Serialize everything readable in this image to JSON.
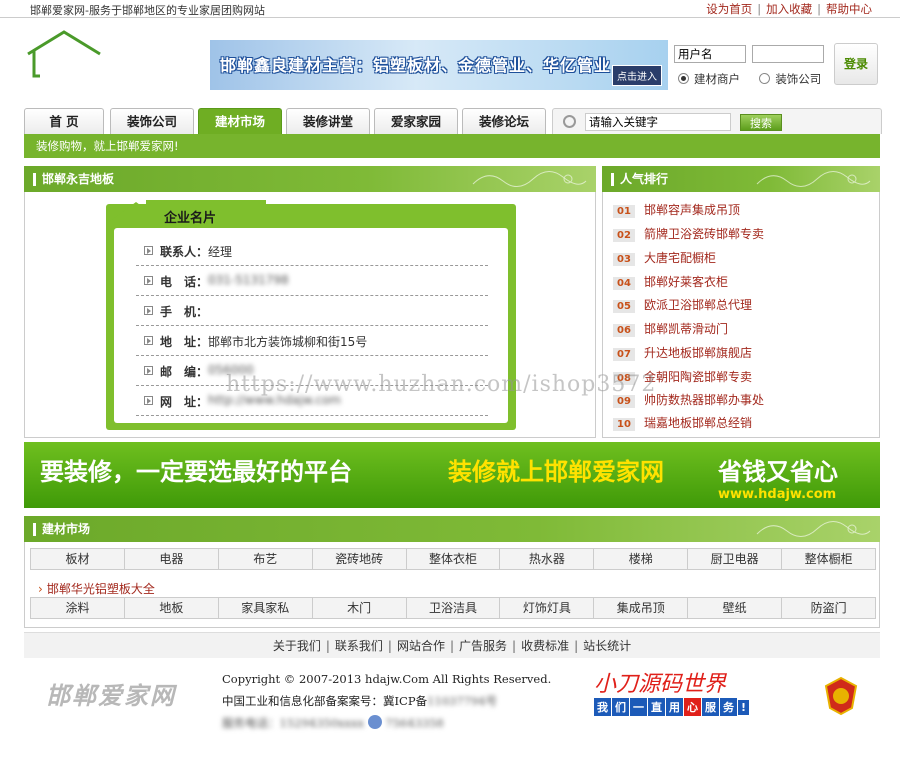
{
  "topbar": {
    "slogan": "邯郸爱家网-服务于邯郸地区的专业家居团购网站",
    "links": [
      "设为首页",
      "加入收藏",
      "帮助中心"
    ]
  },
  "banner": {
    "text": "邯郸鑫良建材主营：铝塑板材、金德管业、华亿管业",
    "enter": "点击进入"
  },
  "login": {
    "username_value": "用户名",
    "password_value": "",
    "radio_options": [
      "建材商户",
      "装饰公司"
    ],
    "selected": "建材商户",
    "button": "登录"
  },
  "nav": {
    "tabs": [
      "首 页",
      "装饰公司",
      "建材市场",
      "装修讲堂",
      "爱家家园",
      "装修论坛"
    ],
    "active": "建材市场",
    "search_value": "请输入关键字",
    "search_button": "搜索"
  },
  "subbar": "装修购物，就上邯郸爱家网!",
  "company_panel": {
    "title": "邯郸永吉地板",
    "card_title": "企业名片",
    "rows": [
      {
        "label": "联系人：",
        "value": "经理"
      },
      {
        "label": "电　话：",
        "value": "031-5131798"
      },
      {
        "label": "手　机：",
        "value": ""
      },
      {
        "label": "地　址：",
        "value": "邯郸市北方装饰城柳和街15号"
      },
      {
        "label": "邮　编：",
        "value": "056000"
      },
      {
        "label": "网　址：",
        "value": "http://www.hdajw.com"
      }
    ]
  },
  "ranking": {
    "title": "人气排行",
    "items": [
      {
        "no": "01",
        "name": "邯郸容声集成吊顶"
      },
      {
        "no": "02",
        "name": "箭牌卫浴瓷砖邯郸专卖"
      },
      {
        "no": "03",
        "name": "大唐宅配橱柜"
      },
      {
        "no": "04",
        "name": "邯郸好莱客衣柜"
      },
      {
        "no": "05",
        "name": "欧派卫浴邯郸总代理"
      },
      {
        "no": "06",
        "name": "邯郸凯蒂滑动门"
      },
      {
        "no": "07",
        "name": "升达地板邯郸旗舰店"
      },
      {
        "no": "08",
        "name": "金朝阳陶瓷邯郸专卖"
      },
      {
        "no": "09",
        "name": "帅防数热器邯郸办事处"
      },
      {
        "no": "10",
        "name": "瑞嘉地板邯郸总经销"
      }
    ]
  },
  "promo": {
    "part1": "要装修，一定要选最好的平台",
    "part2": "装修就上邯郸爱家网",
    "part3": "省钱又省心",
    "url": "www.hdajw.com"
  },
  "market": {
    "title": "建材市场",
    "row1": [
      "板材",
      "电器",
      "布艺",
      "瓷砖地砖",
      "整体衣柜",
      "热水器",
      "楼梯",
      "厨卫电器",
      "整体橱柜"
    ],
    "featured": "邯郸华光铝塑板大全",
    "row2": [
      "涂料",
      "地板",
      "家具家私",
      "木门",
      "卫浴洁具",
      "灯饰灯具",
      "集成吊顶",
      "壁纸",
      "防盗门"
    ]
  },
  "footer": {
    "links": [
      "关于我们",
      "联系我们",
      "网站合作",
      "广告服务",
      "收费标准",
      "站长统计"
    ],
    "logo_text": "邯郸爱家网",
    "copyright": "Copyright © 2007-2013 hdajw.Com All Rights Reserved.",
    "icp": "中国工业和信息化部备案案号：冀ICP备",
    "phone": "服务电话：15294350xxxx",
    "qq": "75643358",
    "badge_title": "小刀源码世界",
    "badge_chars": [
      "我",
      "们",
      "一",
      "直",
      "用",
      "心",
      "服",
      "务",
      "!"
    ]
  },
  "watermark": "https://www.huzhan.com/ishop3572",
  "colors": {
    "brand_green": "#77b42d",
    "link_red": "#a3291e",
    "promo_yellow": "#ffe200"
  }
}
